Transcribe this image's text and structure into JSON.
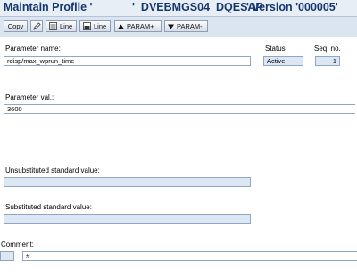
{
  "title": {
    "part1": "Maintain Profile '",
    "part2": "'_DVEBMGS04_DQESAP",
    "part3": "' Version '000005'"
  },
  "toolbar": {
    "copy_label": "Copy",
    "line1_label": "Line",
    "line2_label": "Line",
    "param_plus_label": "PARAM+",
    "param_minus_label": "PARAM-"
  },
  "form": {
    "parameter_name_label": "Parameter name:",
    "parameter_name_value": "rdisp/max_wprun_time",
    "status_label": "Status",
    "status_value": "Active",
    "seq_label": "Seq. no.",
    "seq_value": "1",
    "parameter_value_label": "Parameter val.:",
    "parameter_value": "3600",
    "unsubstituted_label": "Unsubstituted standard value:",
    "unsubstituted_value": "",
    "substituted_label": "Substituted standard value:",
    "substituted_value": "",
    "comment_label": "Comment:",
    "comment_prefix_value": "",
    "comment_value": "#"
  }
}
